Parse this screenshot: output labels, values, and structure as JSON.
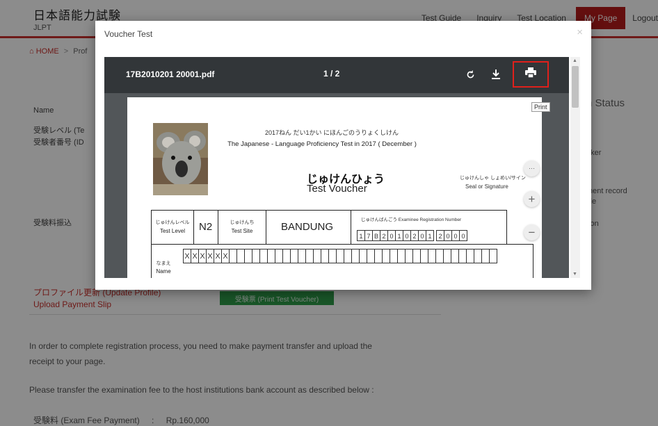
{
  "header": {
    "logo_jp": "日本語能力試験",
    "logo_en": "JLPT",
    "nav": [
      "Test Guide",
      "Inquiry",
      "Test Location",
      "My Page",
      "Logout"
    ]
  },
  "breadcrumb": {
    "home": "HOME",
    "current": "Prof"
  },
  "info": {
    "name_label": "Name",
    "level_label": "受験レベル (Te",
    "number_label": "受験者番号 (ID",
    "fee_label": "受験料振込"
  },
  "side": {
    "status_title": "n Status",
    "links": [
      "aker",
      "ment record\nfile",
      "tion"
    ]
  },
  "profile_link": "プロファイル更新 (Update Profile)\nUpload Payment Slip",
  "green_button": "受験票 (Print Test Voucher)",
  "paragraphs": [
    "In order to complete registration process, you need to make payment transfer and upload the\nreceipt to your page.",
    "Please transfer the examination fee to the host institutions bank account as described below :"
  ],
  "fee": {
    "label": "受験料 (Exam Fee Payment)",
    "colon": ":",
    "value": "Rp.160,000"
  },
  "modal": {
    "title": "Voucher Test",
    "close": "×",
    "file_name": "17B2010201 20001.pdf",
    "page_indicator": "1 / 2",
    "tooltip": "Print",
    "icons": [
      "refresh-icon",
      "download-icon",
      "print-icon"
    ]
  },
  "pdf": {
    "subheading_jp": "2017ねん だい1かい にほんごのうりょくしけん",
    "heading": "The Japanese -  Language Proficiency Test in 2017 ( December )",
    "voucher_jp": "じゅけんひょう",
    "voucher_en": "Test  Voucher",
    "seal_jp": "じゅけんしゃ しょめい/サイン",
    "seal_en": "Seal or Signature",
    "level_jp": "じゅけんレベル",
    "level_en": "Test Level",
    "level_value": "N2",
    "site_jp": "じゅけんち",
    "site_en": "Test Site",
    "site_value": "BANDUNG",
    "regno_label": "じゅけんばんごう Examinee Registration Number",
    "regno_digits": [
      "1",
      "7",
      "B",
      "2",
      "0",
      "1",
      "0",
      "2",
      "0",
      "1",
      "",
      "2",
      "0",
      "0",
      "0"
    ],
    "name_jp": "なまえ",
    "name_en": "Name",
    "name_chars": [
      "X",
      "X",
      "X",
      "X",
      "X",
      "X",
      "",
      "",
      "",
      "",
      "",
      "",
      "",
      "",
      "",
      "",
      "",
      "",
      "",
      "",
      "",
      "",
      "",
      "",
      "",
      "",
      "",
      "",
      "",
      "",
      "",
      "",
      "",
      "",
      "",
      "",
      "",
      "",
      "",
      "",
      ""
    ]
  },
  "colors": {
    "accent": "#c9302c",
    "toolbar": "#323639",
    "viewer_bg": "#525659",
    "highlight": "#e0201b",
    "green": "#2e9d4a"
  }
}
